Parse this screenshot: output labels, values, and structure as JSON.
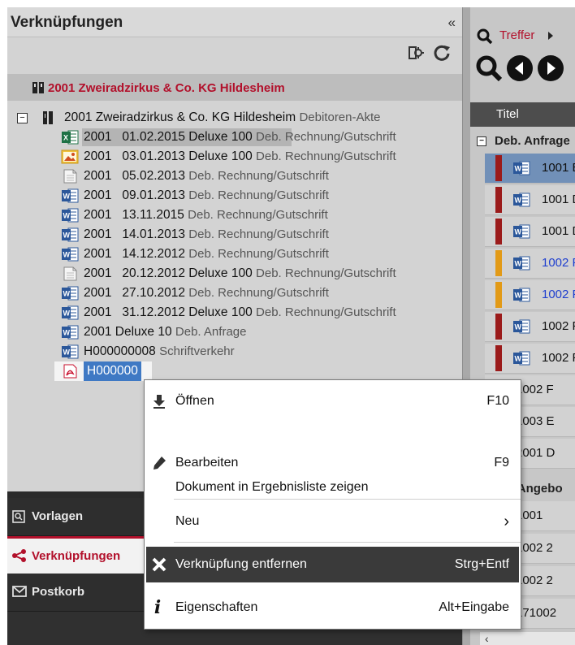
{
  "left_panel": {
    "title": "Verknüpfungen",
    "collapse_symbol": "«",
    "group_label": "2001 Zweiradzirkus & Co. KG Hildesheim",
    "root": {
      "toggle": "−",
      "label": "2001 Zweiradzirkus & Co. KG Hildesheim",
      "type": "Debitoren-Akte"
    },
    "items": [
      {
        "icon": "excel-file-icon",
        "id": "2001",
        "date": "01.02.2015",
        "name": "Deluxe 100",
        "type": "Deb. Rechnung/Gutschrift",
        "highlight": true
      },
      {
        "icon": "image-file-icon",
        "id": "2001",
        "date": "03.01.2013",
        "name": "Deluxe 100",
        "type": "Deb. Rechnung/Gutschrift",
        "highlight": false
      },
      {
        "icon": "blank-file-icon",
        "id": "2001",
        "date": "05.02.2013",
        "name": "",
        "type": "Deb. Rechnung/Gutschrift",
        "highlight": false
      },
      {
        "icon": "word-file-icon",
        "id": "2001",
        "date": "09.01.2013",
        "name": "",
        "type": "Deb. Rechnung/Gutschrift",
        "highlight": false
      },
      {
        "icon": "word-file-icon",
        "id": "2001",
        "date": "13.11.2015",
        "name": "",
        "type": "Deb. Rechnung/Gutschrift",
        "highlight": false
      },
      {
        "icon": "word-file-icon",
        "id": "2001",
        "date": "14.01.2013",
        "name": "",
        "type": "Deb. Rechnung/Gutschrift",
        "highlight": false
      },
      {
        "icon": "word-file-icon",
        "id": "2001",
        "date": "14.12.2012",
        "name": "",
        "type": "Deb. Rechnung/Gutschrift",
        "highlight": false
      },
      {
        "icon": "blank-file-icon",
        "id": "2001",
        "date": "20.12.2012",
        "name": "Deluxe 100",
        "type": "Deb. Rechnung/Gutschrift",
        "highlight": false
      },
      {
        "icon": "word-file-icon",
        "id": "2001",
        "date": "27.10.2012",
        "name": "",
        "type": "Deb. Rechnung/Gutschrift",
        "highlight": false
      },
      {
        "icon": "word-file-icon",
        "id": "2001",
        "date": "31.12.2012",
        "name": "Deluxe 100",
        "type": "Deb. Rechnung/Gutschrift",
        "highlight": false
      },
      {
        "icon": "word-file-icon",
        "id": "2001",
        "date": "",
        "name": "Deluxe 10",
        "type": "Deb. Anfrage",
        "highlight": false
      },
      {
        "icon": "word-file-icon",
        "id": "H000000008",
        "date": "",
        "name": "",
        "type": "Schriftverkehr",
        "highlight": false
      },
      {
        "icon": "pdf-file-icon",
        "id": "H000000",
        "date": "",
        "name": "",
        "type": "",
        "highlight": false,
        "selected": true
      }
    ]
  },
  "nav": {
    "items": [
      {
        "label": "Vorlagen",
        "icon": "template-icon",
        "active": false
      },
      {
        "label": "Verknüpfungen",
        "icon": "share-icon",
        "active": true
      },
      {
        "label": "Postkorb",
        "icon": "mail-icon",
        "active": false
      }
    ]
  },
  "right_panel": {
    "search_link": "Treffer",
    "column_title": "Titel",
    "groups": [
      {
        "toggle": "−",
        "label": "Deb. Anfrage"
      },
      {
        "toggle": "",
        "label": ". Angebo"
      }
    ],
    "rows": [
      {
        "text": "1001 E",
        "stripe": "#9b1b1b",
        "doc": true,
        "selected": true,
        "blue": false
      },
      {
        "text": "1001 D",
        "stripe": "#9b1b1b",
        "doc": true,
        "selected": false,
        "blue": false
      },
      {
        "text": "1001 D",
        "stripe": "#9b1b1b",
        "doc": true,
        "selected": false,
        "blue": false
      },
      {
        "text": "1002 F",
        "stripe": "#e29a17",
        "doc": true,
        "selected": false,
        "blue": true
      },
      {
        "text": "1002 F",
        "stripe": "#e29a17",
        "doc": true,
        "selected": false,
        "blue": true
      },
      {
        "text": "1002 F",
        "stripe": "#9b1b1b",
        "doc": true,
        "selected": false,
        "blue": false
      },
      {
        "text": "1002 F",
        "stripe": "#9b1b1b",
        "doc": true,
        "selected": false,
        "blue": false
      },
      {
        "text": "1002 F",
        "stripe": "",
        "doc": false,
        "selected": false,
        "blue": false
      },
      {
        "text": "1003 E",
        "stripe": "",
        "doc": false,
        "selected": false,
        "blue": false
      },
      {
        "text": "2001 D",
        "stripe": "",
        "doc": false,
        "selected": false,
        "blue": false
      }
    ],
    "rows2": [
      {
        "text": "1001"
      },
      {
        "text": "1002 2"
      },
      {
        "text": "1002 2"
      },
      {
        "text": "171002"
      }
    ]
  },
  "context_menu": {
    "items": [
      {
        "icon": "download-icon",
        "label": "Öffnen",
        "shortcut": "F10"
      },
      {
        "icon": "pencil-icon",
        "label": "Bearbeiten",
        "shortcut": "F9"
      },
      {
        "icon": "",
        "label": "Dokument in Ergebnisliste zeigen",
        "shortcut": ""
      },
      {
        "icon": "",
        "label": "Neu",
        "shortcut": "›"
      },
      {
        "icon": "close-icon",
        "label": "Verknüpfung entfernen",
        "shortcut": "Strg+Entf",
        "hover": true
      },
      {
        "icon": "info-icon",
        "label": "Eigenschaften",
        "shortcut": "Alt+Eingabe"
      }
    ]
  },
  "colors": {
    "accent": "#b2102b",
    "menu_hover": "#3a3a3a",
    "selection": "#7190b8"
  }
}
